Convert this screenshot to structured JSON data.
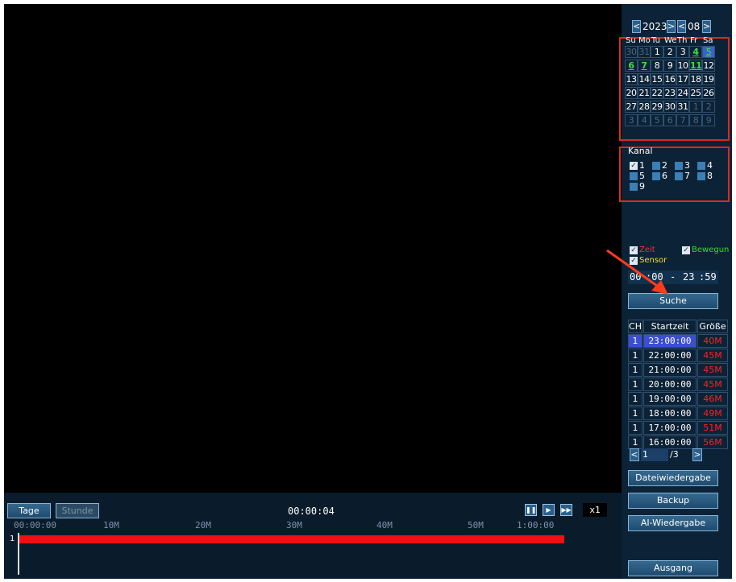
{
  "nav": {
    "prev": "<",
    "year": "2023",
    "next": ">",
    "prev2": "<",
    "month": "08",
    "next2": ">"
  },
  "weekdays": [
    "Su",
    "Mo",
    "Tu",
    "We",
    "Th",
    "Fr",
    "Sa"
  ],
  "calendar": [
    [
      {
        "d": "30",
        "t": "other"
      },
      {
        "d": "31",
        "t": "other"
      },
      {
        "d": "1",
        "t": "n"
      },
      {
        "d": "2",
        "t": "n"
      },
      {
        "d": "3",
        "t": "n"
      },
      {
        "d": "4",
        "t": "rec"
      },
      {
        "d": "5",
        "t": "sel"
      }
    ],
    [
      {
        "d": "6",
        "t": "rec"
      },
      {
        "d": "7",
        "t": "rec"
      },
      {
        "d": "8",
        "t": "n"
      },
      {
        "d": "9",
        "t": "n"
      },
      {
        "d": "10",
        "t": "n"
      },
      {
        "d": "11",
        "t": "rec"
      },
      {
        "d": "12",
        "t": "n"
      }
    ],
    [
      {
        "d": "13",
        "t": "n"
      },
      {
        "d": "14",
        "t": "n"
      },
      {
        "d": "15",
        "t": "n"
      },
      {
        "d": "16",
        "t": "n"
      },
      {
        "d": "17",
        "t": "n"
      },
      {
        "d": "18",
        "t": "n"
      },
      {
        "d": "19",
        "t": "n"
      }
    ],
    [
      {
        "d": "20",
        "t": "n"
      },
      {
        "d": "21",
        "t": "n"
      },
      {
        "d": "22",
        "t": "n"
      },
      {
        "d": "23",
        "t": "n"
      },
      {
        "d": "24",
        "t": "n"
      },
      {
        "d": "25",
        "t": "n"
      },
      {
        "d": "26",
        "t": "n"
      }
    ],
    [
      {
        "d": "27",
        "t": "n"
      },
      {
        "d": "28",
        "t": "n"
      },
      {
        "d": "29",
        "t": "n"
      },
      {
        "d": "30",
        "t": "n"
      },
      {
        "d": "31",
        "t": "n"
      },
      {
        "d": "1",
        "t": "other"
      },
      {
        "d": "2",
        "t": "other"
      }
    ],
    [
      {
        "d": "3",
        "t": "other"
      },
      {
        "d": "4",
        "t": "other"
      },
      {
        "d": "5",
        "t": "other"
      },
      {
        "d": "6",
        "t": "other"
      },
      {
        "d": "7",
        "t": "other"
      },
      {
        "d": "8",
        "t": "other"
      },
      {
        "d": "9",
        "t": "other"
      }
    ]
  ],
  "kanal": {
    "title": "Kanal",
    "channels": [
      {
        "n": "1",
        "checked": true
      },
      {
        "n": "2",
        "checked": false
      },
      {
        "n": "3",
        "checked": false
      },
      {
        "n": "4",
        "checked": false
      },
      {
        "n": "5",
        "checked": false
      },
      {
        "n": "6",
        "checked": false
      },
      {
        "n": "7",
        "checked": false
      },
      {
        "n": "8",
        "checked": false
      },
      {
        "n": "9",
        "checked": false
      }
    ]
  },
  "types": {
    "zeit": "Zeit",
    "bewegung": "Bewegun",
    "sensor": "Sensor"
  },
  "type_colors": {
    "zeit": "#ff2a2a",
    "bewegung": "#2ee02e",
    "sensor": "#f2e12a"
  },
  "time_range": {
    "start_h": "00",
    "start_m": ":00",
    "sep": "-",
    "end_h": "23",
    "end_m": ":59"
  },
  "buttons": {
    "suche": "Suche",
    "dateiwiedergabe": "Dateiwiedergabe",
    "backup": "Backup",
    "ai": "AI-Wiedergabe",
    "ausgang": "Ausgang"
  },
  "table": {
    "headers": [
      "CH",
      "Startzeit",
      "Größe"
    ],
    "rows": [
      {
        "ch": "1",
        "start": "23:00:00",
        "size": "40M",
        "selected": true
      },
      {
        "ch": "1",
        "start": "22:00:00",
        "size": "45M",
        "selected": false
      },
      {
        "ch": "1",
        "start": "21:00:00",
        "size": "45M",
        "selected": false
      },
      {
        "ch": "1",
        "start": "20:00:00",
        "size": "45M",
        "selected": false
      },
      {
        "ch": "1",
        "start": "19:00:00",
        "size": "46M",
        "selected": false
      },
      {
        "ch": "1",
        "start": "18:00:00",
        "size": "49M",
        "selected": false
      },
      {
        "ch": "1",
        "start": "17:00:00",
        "size": "51M",
        "selected": false
      },
      {
        "ch": "1",
        "start": "16:00:00",
        "size": "56M",
        "selected": false
      }
    ]
  },
  "pager": {
    "prev": "<",
    "page": "1",
    "total": "/3",
    "next": ">"
  },
  "timeline": {
    "tage": "Tage",
    "stunde": "Stunde",
    "current_time": "00:00:04",
    "speed": "x1",
    "ticks": [
      "00:00:00",
      "10M",
      "20M",
      "30M",
      "40M",
      "50M",
      "1:00:00"
    ],
    "channel_label": "1",
    "recording_fraction": 1.0,
    "bar_color": "#ee1111"
  },
  "controls": {
    "pause": "❚❚",
    "play": "▶",
    "forward": "▶▶"
  }
}
